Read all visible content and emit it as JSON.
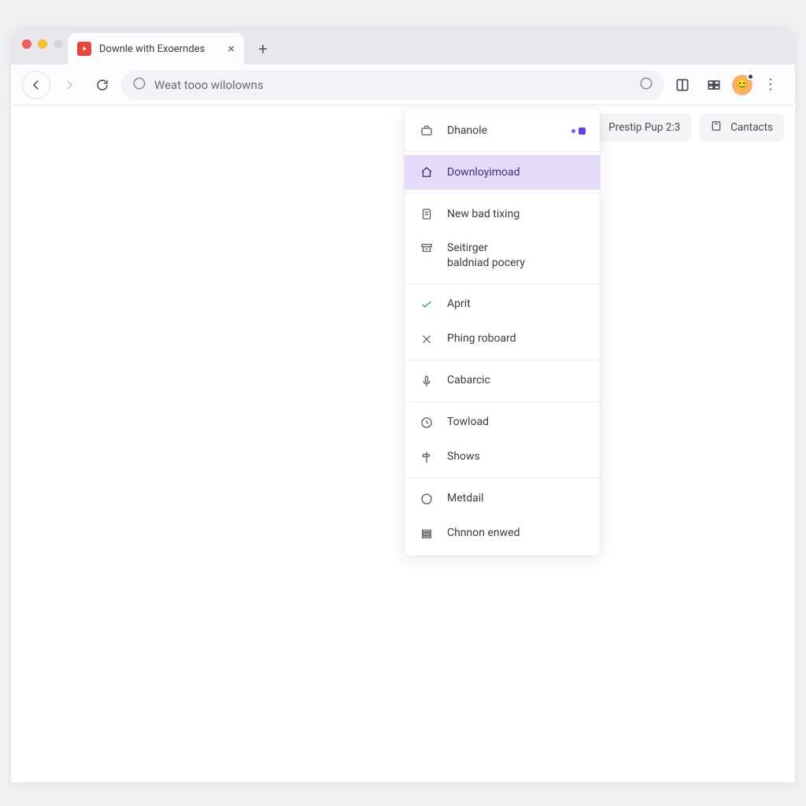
{
  "tab": {
    "title": "Downle with Exoerndes"
  },
  "address": {
    "text": "Weat tooo wilolowns"
  },
  "chips": {
    "prestip": "Prestip Pup 2:3",
    "contacts": "Cantacts"
  },
  "menu": {
    "items": [
      {
        "label": "Dhanole"
      },
      {
        "label": "Downloyimoad"
      },
      {
        "label": "New bad tixing"
      },
      {
        "label": "Seitirger",
        "sub": "baldniad pocery"
      },
      {
        "label": "Aprit"
      },
      {
        "label": "Phing roboard"
      },
      {
        "label": "Cabarcic"
      },
      {
        "label": "Towload"
      },
      {
        "label": "Shows"
      },
      {
        "label": "Metdail"
      },
      {
        "label": "Chnnon enwed"
      }
    ]
  },
  "avatar": {
    "emoji": "😊"
  }
}
